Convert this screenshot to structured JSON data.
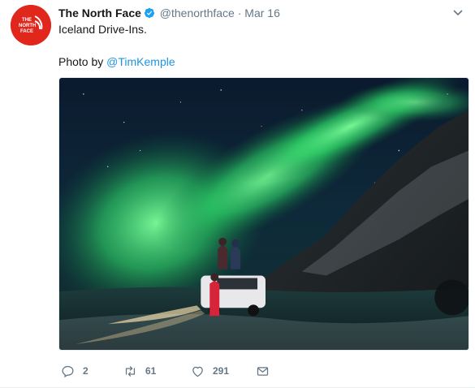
{
  "account": {
    "name": "The North Face",
    "handle": "@thenorthface",
    "separator": "·",
    "date": "Mar 16",
    "logo_text": [
      "THE",
      "NORTH",
      "FACE"
    ]
  },
  "tweet": {
    "text": "Iceland Drive-Ins.",
    "photo_credit_prefix": "Photo by ",
    "photo_credit_mention": "@TimKemple"
  },
  "actions": {
    "reply_count": "2",
    "retweet_count": "61",
    "like_count": "291"
  },
  "colors": {
    "brand_red": "#e1261c",
    "link_blue": "#1b95e0",
    "muted_gray": "#657786",
    "verified_blue": "#1da1f2"
  },
  "icons": [
    "verified-badge-icon",
    "chevron-down-icon",
    "reply-icon",
    "retweet-icon",
    "heart-icon",
    "envelope-icon"
  ]
}
